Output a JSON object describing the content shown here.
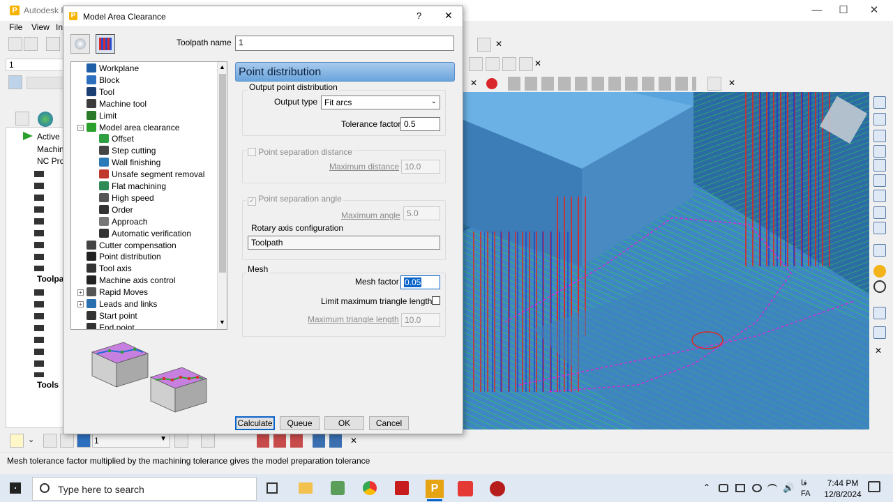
{
  "app": {
    "title": "Autodesk P",
    "window_buttons": {
      "minimize": "—",
      "maximize": "☐",
      "close": "✕"
    },
    "menu": [
      "File",
      "View",
      "In"
    ],
    "toolbar_field_value": "1"
  },
  "explorer": {
    "items": [
      {
        "label": "Active"
      },
      {
        "label": "Machin"
      },
      {
        "label": "NC Prog"
      },
      {
        "label": "Toolpat"
      },
      {
        "label": "Tools"
      }
    ]
  },
  "dialog": {
    "title": "Model Area Clearance",
    "help": "?",
    "close": "✕",
    "toolpath_name_label": "Toolpath name",
    "toolpath_name_value": "1",
    "tree": [
      {
        "label": "Workplane",
        "icon_color": "#1f5fa8",
        "indent": 0,
        "expander": ""
      },
      {
        "label": "Block",
        "icon_color": "#2d6fbf",
        "indent": 0,
        "expander": ""
      },
      {
        "label": "Tool",
        "icon_color": "#1c3f73",
        "indent": 0,
        "expander": ""
      },
      {
        "label": "Machine tool",
        "icon_color": "#3c3c3c",
        "indent": 0,
        "expander": ""
      },
      {
        "label": "Limit",
        "icon_color": "#2a7a2a",
        "indent": 0,
        "expander": ""
      },
      {
        "label": "Model area clearance",
        "icon_color": "#2ca02c",
        "indent": 0,
        "expander": "−"
      },
      {
        "label": "Offset",
        "icon_color": "#2ea043",
        "indent": 1,
        "expander": ""
      },
      {
        "label": "Step cutting",
        "icon_color": "#444444",
        "indent": 1,
        "expander": ""
      },
      {
        "label": "Wall finishing",
        "icon_color": "#2a7ab8",
        "indent": 1,
        "expander": ""
      },
      {
        "label": "Unsafe segment removal",
        "icon_color": "#c0392b",
        "indent": 1,
        "expander": ""
      },
      {
        "label": "Flat machining",
        "icon_color": "#2e8b57",
        "indent": 1,
        "expander": ""
      },
      {
        "label": "High speed",
        "icon_color": "#555555",
        "indent": 1,
        "expander": ""
      },
      {
        "label": "Order",
        "icon_color": "#333333",
        "indent": 1,
        "expander": ""
      },
      {
        "label": "Approach",
        "icon_color": "#777777",
        "indent": 1,
        "expander": ""
      },
      {
        "label": "Automatic verification",
        "icon_color": "#333333",
        "indent": 1,
        "expander": ""
      },
      {
        "label": "Cutter compensation",
        "icon_color": "#444444",
        "indent": 0,
        "expander": ""
      },
      {
        "label": "Point distribution",
        "icon_color": "#222222",
        "indent": 0,
        "expander": ""
      },
      {
        "label": "Tool axis",
        "icon_color": "#333333",
        "indent": 0,
        "expander": ""
      },
      {
        "label": "Machine axis control",
        "icon_color": "#222222",
        "indent": 0,
        "expander": ""
      },
      {
        "label": "Rapid Moves",
        "icon_color": "#555555",
        "indent": 0,
        "expander": "+"
      },
      {
        "label": "Leads and links",
        "icon_color": "#2a6fb0",
        "indent": 0,
        "expander": "+"
      },
      {
        "label": "Start point",
        "icon_color": "#333333",
        "indent": 0,
        "expander": ""
      },
      {
        "label": "End point",
        "icon_color": "#333333",
        "indent": 0,
        "expander": ""
      }
    ],
    "section_title": "Point distribution",
    "output_group": {
      "title": "Output point distribution",
      "output_type_label": "Output type",
      "output_type_value": "Fit arcs",
      "tolerance_label": "Tolerance factor",
      "tolerance_value": "0.5"
    },
    "separation_distance": {
      "label": "Point separation distance",
      "max_label": "Maximum distance",
      "max_value": "10.0"
    },
    "separation_angle": {
      "label": "Point separation angle",
      "max_label": "Maximum angle",
      "max_value": "5.0",
      "rotary_label": "Rotary axis configuration",
      "rotary_value": "Toolpath"
    },
    "mesh": {
      "title": "Mesh",
      "factor_label": "Mesh factor",
      "factor_value": "0.05",
      "limit_label": "Limit maximum triangle length",
      "max_triangle_label": "Maximum triangle length",
      "max_triangle_value": "10.0"
    },
    "buttons": {
      "calculate": "Calculate",
      "queue": "Queue",
      "ok": "OK",
      "cancel": "Cancel"
    }
  },
  "bottom_toolbar": {
    "value": "1"
  },
  "status": "Mesh tolerance factor multiplied by the machining tolerance gives the model preparation tolerance",
  "taskbar": {
    "search_placeholder": "Type here to search",
    "time": "7:44 PM",
    "date": "12/8/2024",
    "lang": "FA",
    "lang_top": "فا"
  },
  "colors": {
    "accent": "#5b8fc7",
    "viewport_part": "#4d91c9",
    "toolpath_red": "#e0261f",
    "toolpath_green": "#2fd14a",
    "toolpath_magenta": "#d42bd4"
  }
}
